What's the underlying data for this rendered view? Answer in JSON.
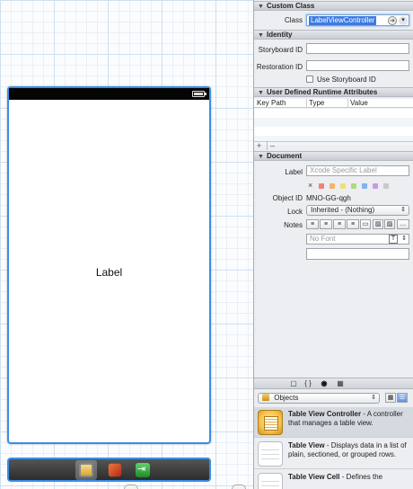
{
  "scene": {
    "label_text": "Label"
  },
  "inspector": {
    "custom_class": {
      "header": "Custom Class",
      "class_label": "Class",
      "class_value": "LabelViewController"
    },
    "identity": {
      "header": "Identity",
      "storyboard_id_label": "Storyboard ID",
      "storyboard_id_value": "",
      "restoration_id_label": "Restoration ID",
      "restoration_id_value": "",
      "use_storyboard_id_label": "Use Storyboard ID",
      "use_storyboard_id_checked": false
    },
    "runtime_attributes": {
      "header": "User Defined Runtime Attributes",
      "columns": [
        "Key Path",
        "Type",
        "Value"
      ],
      "add_label": "+",
      "remove_label": "–"
    },
    "document": {
      "header": "Document",
      "label_label": "Label",
      "label_placeholder": "Xcode Specific Label",
      "clear_label": "×",
      "swatch_colors": [
        "#f08080",
        "#f7b26b",
        "#f0e070",
        "#a6dd7a",
        "#7fb4f0",
        "#c79be6",
        "#c8c8c8"
      ],
      "object_id_label": "Object ID",
      "object_id_value": "MNO-GG-qgh",
      "lock_label": "Lock",
      "lock_value": "Inherited - (Nothing)",
      "notes_label": "Notes",
      "font_placeholder": "No Font"
    }
  },
  "library": {
    "filter_value": "Objects",
    "items": [
      {
        "title": "Table View Controller",
        "desc": " - A controller that manages a table view."
      },
      {
        "title": "Table View",
        "desc": " - Displays data in a list of plain, sectioned, or grouped rows."
      },
      {
        "title": "Table View Cell",
        "desc": " - Defines the"
      }
    ]
  }
}
